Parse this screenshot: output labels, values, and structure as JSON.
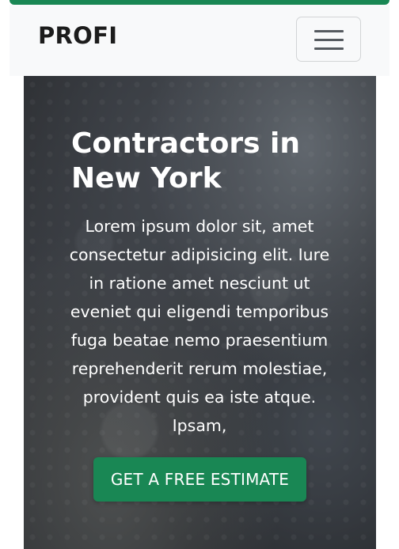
{
  "navbar": {
    "brand": "PROFI",
    "toggler_icon": "hamburger-icon"
  },
  "hero": {
    "title": "Contractors in New York",
    "text": "Lorem ipsum dolor sit, amet consectetur adipisicing elit. Iure in ratione amet nesciunt ut eveniet qui eligendi temporibus fuga beatae nemo praesentium reprehenderit rerum molestiae, provident quis ea iste atque. Ipsam,",
    "cta_label": "GET A FREE ESTIMATE"
  },
  "colors": {
    "accent": "#198754",
    "navbar_bg": "#f8f9fa"
  }
}
